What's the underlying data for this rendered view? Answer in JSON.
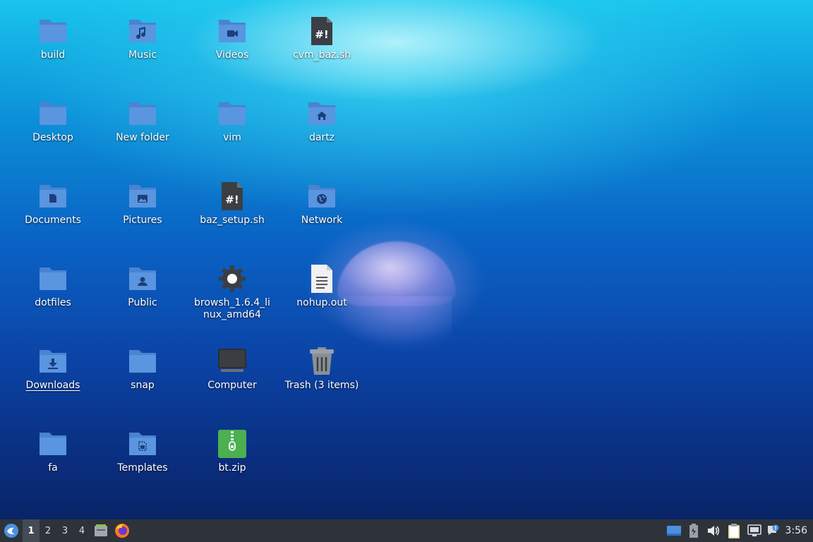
{
  "desktop": {
    "icons": [
      {
        "id": "build",
        "label": "build",
        "type": "folder"
      },
      {
        "id": "music",
        "label": "Music",
        "type": "folder-music"
      },
      {
        "id": "videos",
        "label": "Videos",
        "type": "folder-videos"
      },
      {
        "id": "cvm",
        "label": "cvm_baz.sh",
        "type": "script"
      },
      {
        "id": "desktop",
        "label": "Desktop",
        "type": "folder"
      },
      {
        "id": "newfolder",
        "label": "New folder",
        "type": "folder"
      },
      {
        "id": "vim",
        "label": "vim",
        "type": "folder"
      },
      {
        "id": "dartz",
        "label": "dartz",
        "type": "folder-home"
      },
      {
        "id": "documents",
        "label": "Documents",
        "type": "folder-documents"
      },
      {
        "id": "pictures",
        "label": "Pictures",
        "type": "folder-pictures"
      },
      {
        "id": "bazsetup",
        "label": "baz_setup.sh",
        "type": "script"
      },
      {
        "id": "network",
        "label": "Network",
        "type": "folder-network"
      },
      {
        "id": "dotfiles",
        "label": "dotfiles",
        "type": "folder"
      },
      {
        "id": "public",
        "label": "Public",
        "type": "folder-public"
      },
      {
        "id": "browsh",
        "label": "browsh_1.6.4_linux_amd64",
        "type": "gear"
      },
      {
        "id": "nohup",
        "label": "nohup.out",
        "type": "text"
      },
      {
        "id": "downloads",
        "label": "Downloads",
        "type": "folder-downloads"
      },
      {
        "id": "snap",
        "label": "snap",
        "type": "folder"
      },
      {
        "id": "computer",
        "label": "Computer",
        "type": "computer"
      },
      {
        "id": "trash",
        "label": "Trash (3 items)",
        "type": "trash"
      },
      {
        "id": "fa",
        "label": "fa",
        "type": "folder"
      },
      {
        "id": "templates",
        "label": "Templates",
        "type": "folder-templates"
      },
      {
        "id": "btzip",
        "label": "bt.zip",
        "type": "zip"
      }
    ]
  },
  "taskbar": {
    "workspaces": [
      "1",
      "2",
      "3",
      "4"
    ],
    "active_workspace": "1",
    "clock": "3:56",
    "icons": [
      "start-menu-icon",
      "file-manager-icon",
      "firefox-icon",
      "window-icon",
      "battery-icon",
      "volume-icon",
      "clipboard-icon",
      "network-icon",
      "notification-icon"
    ]
  },
  "colors": {
    "folder": "#5a95e0",
    "folder_tab": "#4a83d0",
    "taskbar": "#2e333a"
  }
}
